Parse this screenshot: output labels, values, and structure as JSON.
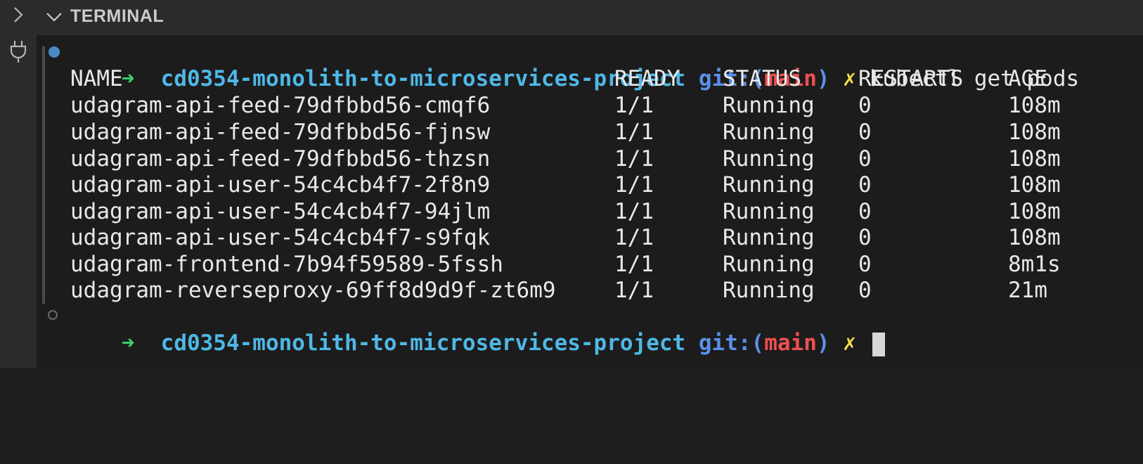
{
  "panel": {
    "title": "TERMINAL",
    "icons": {
      "expand": "chevron-right-icon",
      "collapse": "chevron-down-icon",
      "plug": "plug-icon"
    }
  },
  "prompt": {
    "arrow": "➜",
    "directory": "cd0354-monolith-to-microservices-project",
    "git_label": "git:",
    "branch_open": "(",
    "branch": "main",
    "branch_close": ")",
    "dirty_marker": "✗",
    "command": "kubectl get pods"
  },
  "table": {
    "headers": [
      "NAME",
      "READY",
      "STATUS",
      "RESTARTS",
      "AGE"
    ],
    "rows": [
      [
        "udagram-api-feed-79dfbbd56-cmqf6",
        "1/1",
        "Running",
        "0",
        "108m"
      ],
      [
        "udagram-api-feed-79dfbbd56-fjnsw",
        "1/1",
        "Running",
        "0",
        "108m"
      ],
      [
        "udagram-api-feed-79dfbbd56-thzsn",
        "1/1",
        "Running",
        "0",
        "108m"
      ],
      [
        "udagram-api-user-54c4cb4f7-2f8n9",
        "1/1",
        "Running",
        "0",
        "108m"
      ],
      [
        "udagram-api-user-54c4cb4f7-94jlm",
        "1/1",
        "Running",
        "0",
        "108m"
      ],
      [
        "udagram-api-user-54c4cb4f7-s9fqk",
        "1/1",
        "Running",
        "0",
        "108m"
      ],
      [
        "udagram-frontend-7b94f59589-5fssh",
        "1/1",
        "Running",
        "0",
        "8m1s"
      ],
      [
        "udagram-reverseproxy-69ff8d9d9f-zt6m9",
        "1/1",
        "Running",
        "0",
        "21m"
      ]
    ]
  },
  "colors": {
    "arrow": "#3fd16b",
    "directory": "#4fb8e6",
    "git": "#5b8fe8",
    "branch": "#ef4f4f",
    "dirty_marker": "#f2e14a",
    "status_dot": "#4a8bc6"
  }
}
